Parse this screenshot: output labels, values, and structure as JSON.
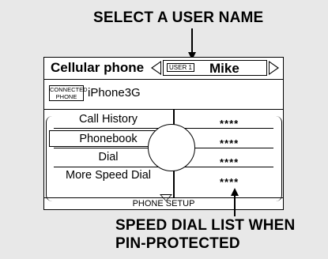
{
  "callouts": {
    "top": "SELECT A USER NAME",
    "bottom_line1": "SPEED DIAL LIST WHEN",
    "bottom_line2": "PIN-PROTECTED"
  },
  "screen": {
    "title": "Cellular phone",
    "user_badge": "USER 1",
    "user_name": "Mike",
    "connected_badge_line1": "CONNECTED",
    "connected_badge_line2": "PHONE",
    "phone_name": "iPhone3G",
    "menu": [
      {
        "label": "Call History",
        "selected": false
      },
      {
        "label": "Phonebook",
        "selected": true
      },
      {
        "label": "Dial",
        "selected": false
      },
      {
        "label": "More Speed Dial",
        "selected": false
      }
    ],
    "speed_dial_masks": [
      "****",
      "****",
      "****",
      "****"
    ],
    "footer": "PHONE SETUP"
  }
}
